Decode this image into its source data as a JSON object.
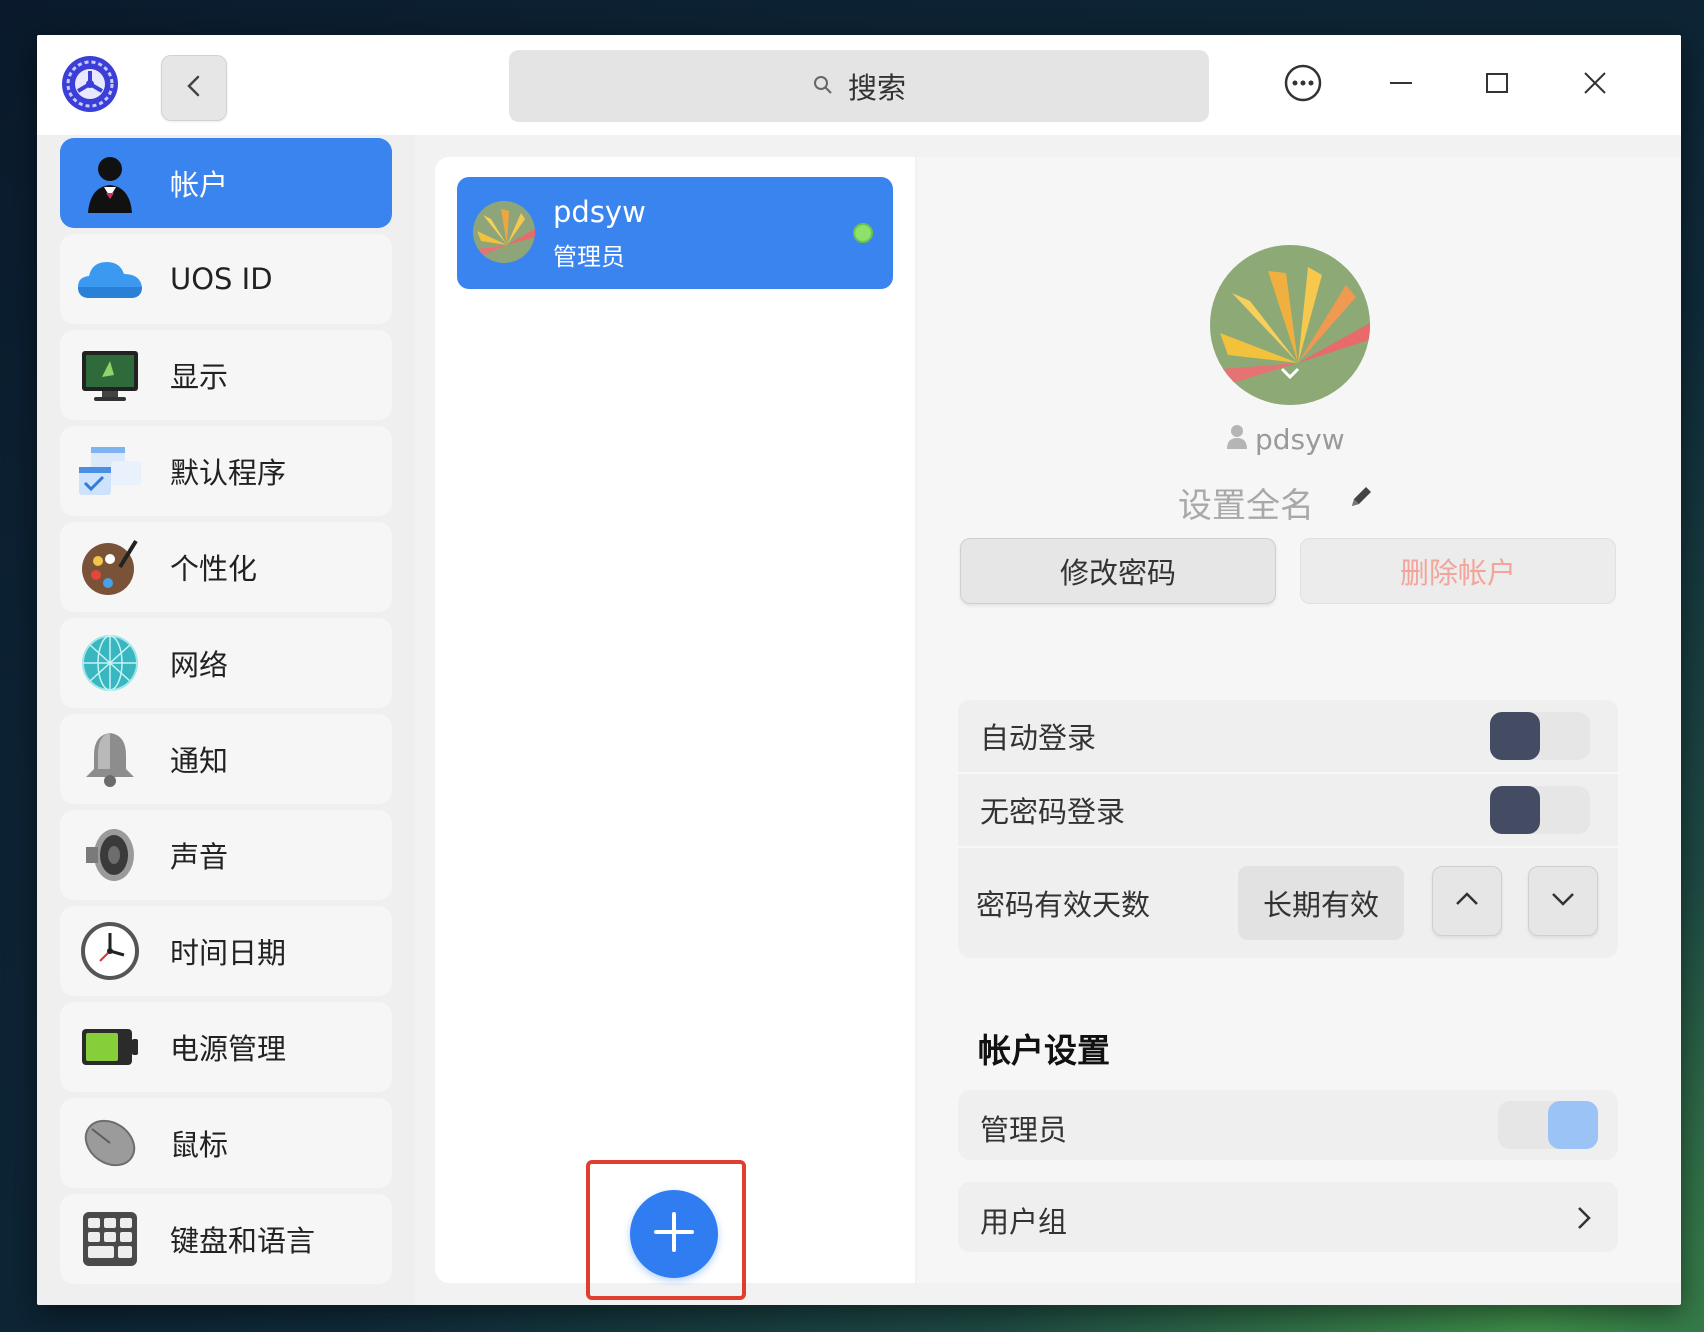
{
  "window": {
    "search_placeholder": "搜索"
  },
  "sidebar": {
    "items": [
      {
        "label": "帐户",
        "icon": "account-icon",
        "active": true
      },
      {
        "label": "UOS ID",
        "icon": "cloud-icon"
      },
      {
        "label": "显示",
        "icon": "display-icon"
      },
      {
        "label": "默认程序",
        "icon": "default-apps-icon"
      },
      {
        "label": "个性化",
        "icon": "palette-icon"
      },
      {
        "label": "网络",
        "icon": "network-globe-icon"
      },
      {
        "label": "通知",
        "icon": "bell-icon"
      },
      {
        "label": "声音",
        "icon": "speaker-icon"
      },
      {
        "label": "时间日期",
        "icon": "clock-icon"
      },
      {
        "label": "电源管理",
        "icon": "battery-icon"
      },
      {
        "label": "鼠标",
        "icon": "mouse-icon"
      },
      {
        "label": "键盘和语言",
        "icon": "keyboard-icon"
      }
    ]
  },
  "user_list": {
    "users": [
      {
        "name": "pdsyw",
        "role": "管理员",
        "online": true
      }
    ]
  },
  "detail": {
    "username": "pdsyw",
    "fullname_placeholder": "设置全名",
    "change_password": "修改密码",
    "delete_account": "删除帐户",
    "auto_login": {
      "label": "自动登录",
      "enabled": false
    },
    "passwordless_login": {
      "label": "无密码登录",
      "enabled": false
    },
    "password_validity": {
      "label": "密码有效天数",
      "value": "长期有效"
    },
    "account_settings_title": "帐户设置",
    "administrator": {
      "label": "管理员",
      "enabled": true
    },
    "user_group": {
      "label": "用户组"
    }
  },
  "colors": {
    "accent": "#3a84f0",
    "online": "#8ee26a",
    "highlight_box": "#e03f2f",
    "delete_text": "#f2a59a"
  }
}
